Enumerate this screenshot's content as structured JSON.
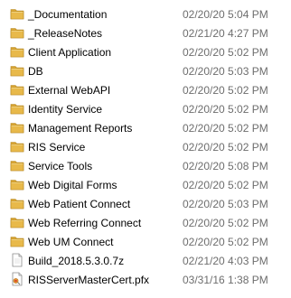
{
  "file_list": {
    "items": [
      {
        "name": "_Documentation",
        "modified": "02/20/20 5:04 PM",
        "icon": "folder-icon"
      },
      {
        "name": "_ReleaseNotes",
        "modified": "02/21/20 4:27 PM",
        "icon": "folder-icon"
      },
      {
        "name": "Client Application",
        "modified": "02/20/20 5:02 PM",
        "icon": "folder-icon"
      },
      {
        "name": "DB",
        "modified": "02/20/20 5:03 PM",
        "icon": "folder-icon"
      },
      {
        "name": "External WebAPI",
        "modified": "02/20/20 5:02 PM",
        "icon": "folder-icon"
      },
      {
        "name": "Identity Service",
        "modified": "02/20/20 5:02 PM",
        "icon": "folder-icon"
      },
      {
        "name": "Management Reports",
        "modified": "02/20/20 5:02 PM",
        "icon": "folder-icon"
      },
      {
        "name": "RIS Service",
        "modified": "02/20/20 5:02 PM",
        "icon": "folder-icon"
      },
      {
        "name": "Service Tools",
        "modified": "02/20/20 5:08 PM",
        "icon": "folder-icon"
      },
      {
        "name": "Web Digital Forms",
        "modified": "02/20/20 5:02 PM",
        "icon": "folder-icon"
      },
      {
        "name": "Web Patient Connect",
        "modified": "02/20/20 5:03 PM",
        "icon": "folder-icon"
      },
      {
        "name": "Web Referring Connect",
        "modified": "02/20/20 5:02 PM",
        "icon": "folder-icon"
      },
      {
        "name": "Web UM Connect",
        "modified": "02/20/20 5:02 PM",
        "icon": "folder-icon"
      },
      {
        "name": "Build_2018.5.3.0.7z",
        "modified": "02/21/20 4:03 PM",
        "icon": "archive-file-icon"
      },
      {
        "name": "RISServerMasterCert.pfx",
        "modified": "03/31/16 1:38 PM",
        "icon": "certificate-file-icon"
      }
    ]
  },
  "colors": {
    "folder_body": "#e8b94a",
    "folder_tab": "#d9a634",
    "date_text": "#6d6d6d"
  }
}
